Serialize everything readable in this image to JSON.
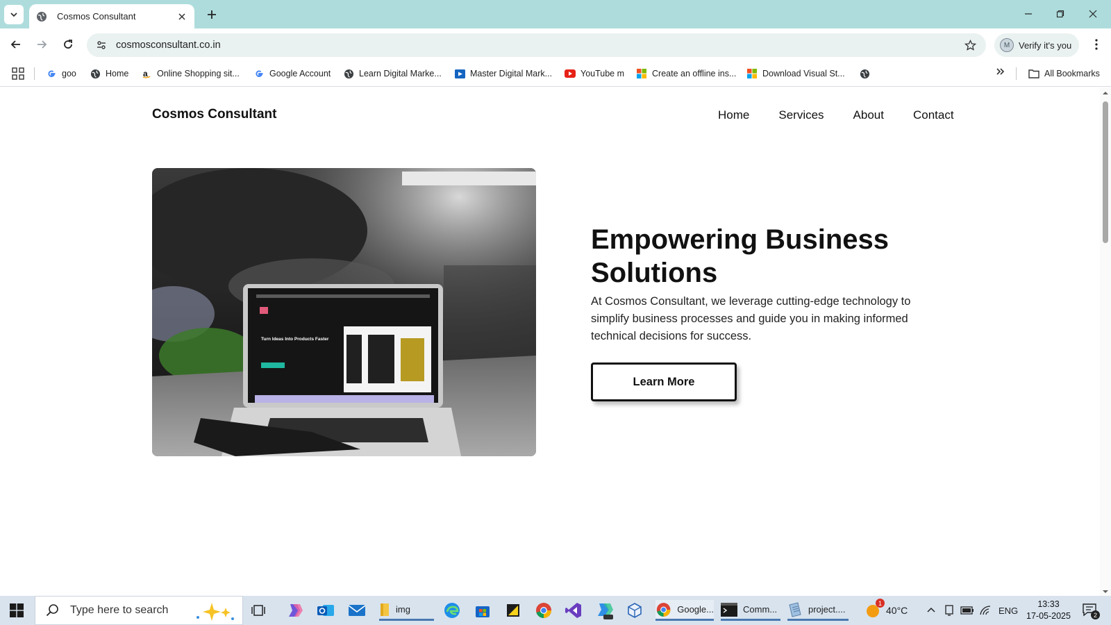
{
  "browser": {
    "tab_title": "Cosmos Consultant",
    "url": "cosmosconsultant.co.in",
    "profile_initial": "M",
    "profile_label": "Verify it's you",
    "bookmarks": [
      {
        "label": "goo",
        "icon": "google-icon"
      },
      {
        "label": "Home",
        "icon": "globe-icon"
      },
      {
        "label": "Online Shopping sit...",
        "icon": "amazon-icon"
      },
      {
        "label": "Google Account",
        "icon": "google-icon"
      },
      {
        "label": "Learn Digital Marke...",
        "icon": "globe-icon"
      },
      {
        "label": "Master Digital Mark...",
        "icon": "video-icon"
      },
      {
        "label": "YouTube m",
        "icon": "youtube-icon"
      },
      {
        "label": "Create an offline ins...",
        "icon": "microsoft-icon"
      },
      {
        "label": "Download Visual St...",
        "icon": "microsoft-icon"
      }
    ],
    "all_bookmarks": "All Bookmarks"
  },
  "site": {
    "brand": "Cosmos Consultant",
    "nav": [
      "Home",
      "Services",
      "About",
      "Contact"
    ],
    "hero_title": "Empowering Business Solutions",
    "hero_desc": "At Cosmos Consultant, we leverage cutting-edge technology to simplify business processes and guide you in making informed technical decisions for success.",
    "cta": "Learn More",
    "hero_image_screen_text": "Turn Ideas Into Products Faster"
  },
  "taskbar": {
    "search_placeholder": "Type here to search",
    "items": [
      {
        "label": "img"
      },
      {
        "label": "Google..."
      },
      {
        "label": "Comm..."
      },
      {
        "label": "project...."
      }
    ],
    "weather": "40°C",
    "language": "ENG",
    "time": "13:33",
    "date": "17-05-2025",
    "notifications": "2",
    "weather_badge": "1"
  },
  "colors": {
    "tabstrip": "#aedcdc",
    "omnibox": "#eaf1f1",
    "taskbar": "#d8e3ee"
  }
}
